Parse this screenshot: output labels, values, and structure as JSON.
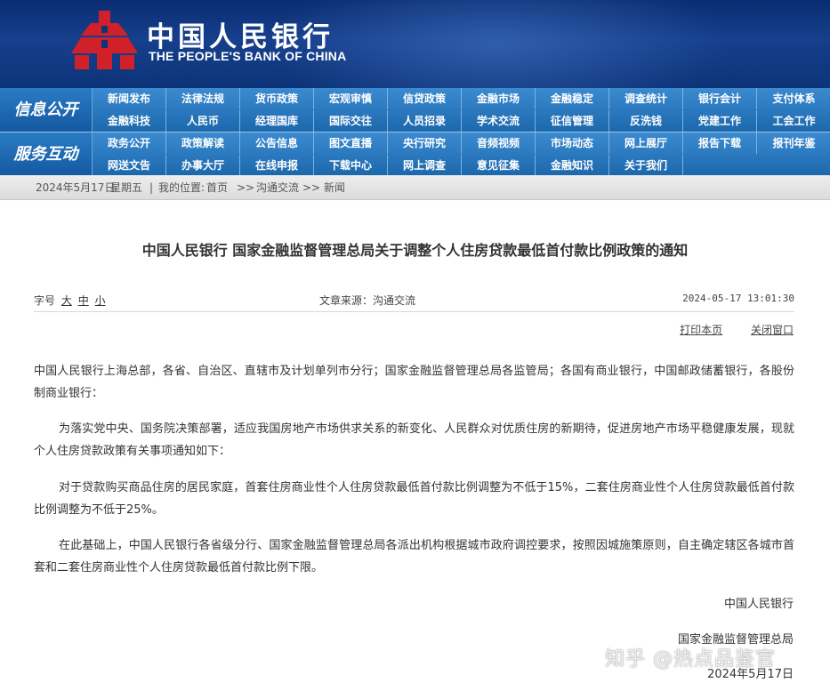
{
  "header": {
    "logo_cn": "中国人民银行",
    "logo_en": "THE PEOPLE'S BANK OF CHINA",
    "colors": {
      "banner": "#0d3479",
      "nav": "#1f6fb4",
      "emblem": "#d0202a"
    }
  },
  "nav": {
    "info_title": "信息公开",
    "info_row1": [
      "新闻发布",
      "法律法规",
      "货币政策",
      "宏观审慎",
      "信贷政策",
      "金融市场",
      "金融稳定",
      "调查统计",
      "银行会计",
      "支付体系"
    ],
    "info_row2": [
      "金融科技",
      "人民币",
      "经理国库",
      "国际交往",
      "人员招录",
      "学术交流",
      "征信管理",
      "反洗钱",
      "党建工作",
      "工会工作"
    ],
    "service_title": "服务互动",
    "service_row1": [
      "政务公开",
      "政策解读",
      "公告信息",
      "图文直播",
      "央行研究",
      "音频视频",
      "市场动态",
      "网上展厅",
      "报告下载",
      "报刊年鉴"
    ],
    "service_row2": [
      "网送文告",
      "办事大厅",
      "在线申报",
      "下载中心",
      "网上调查",
      "意见征集",
      "金融知识",
      "关于我们"
    ]
  },
  "breadcrumb": {
    "date": "2024年5月17日",
    "weekday": "星期五",
    "sep": "|",
    "location_label": "我的位置:",
    "home": "首页",
    "arrow": ">>",
    "section": "沟通交流",
    "current": "新闻"
  },
  "article": {
    "title": "中国人民银行  国家金融监督管理总局关于调整个人住房贷款最低首付款比例政策的通知",
    "font_size_label": "字号",
    "sizes": [
      "大",
      "中",
      "小"
    ],
    "source": "文章来源：沟通交流",
    "datetime": "2024-05-17  13:01:30",
    "print_label": "打印本页",
    "close_label": "关闭窗口",
    "paragraphs": [
      "中国人民银行上海总部，各省、自治区、直辖市及计划单列市分行；国家金融监督管理总局各监管局；各国有商业银行，中国邮政储蓄银行，各股份制商业银行：",
      "为落实党中央、国务院决策部署，适应我国房地产市场供求关系的新变化、人民群众对优质住房的新期待，促进房地产市场平稳健康发展，现就个人住房贷款政策有关事项通知如下：",
      "对于贷款购买商品住房的居民家庭，首套住房商业性个人住房贷款最低首付款比例调整为不低于15%，二套住房商业性个人住房贷款最低首付款比例调整为不低于25%。",
      "在此基础上，中国人民银行各省级分行、国家金融监督管理总局各派出机构根据城市政府调控要求，按照因城施策原则，自主确定辖区各城市首套和二套住房商业性个人住房贷款最低首付款比例下限。"
    ],
    "signature_1": "中国人民银行",
    "signature_2": "国家金融监督管理总局",
    "sign_date": "2024年5月17日"
  },
  "watermark": "知乎 @热点品鉴官"
}
